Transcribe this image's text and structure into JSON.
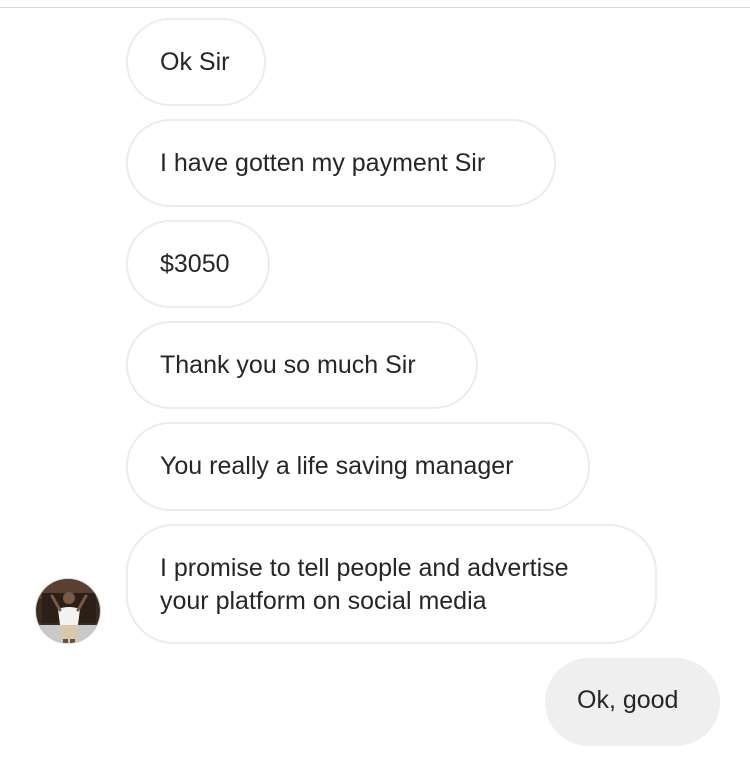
{
  "messages": [
    {
      "from": "them",
      "text": "Ok Sir"
    },
    {
      "from": "them",
      "text": "I have gotten my payment Sir"
    },
    {
      "from": "them",
      "text": "$3050"
    },
    {
      "from": "them",
      "text": "Thank you so much Sir"
    },
    {
      "from": "them",
      "text": "You really a life saving manager"
    },
    {
      "from": "them",
      "lines": [
        "I promise to tell people and advertise",
        "your platform on social media"
      ]
    },
    {
      "from": "me",
      "text": "Ok, good"
    }
  ],
  "avatar": {
    "icon": "profile-photo-icon"
  },
  "colors": {
    "incoming_bg": "#ffffff",
    "incoming_border": "#ececec",
    "outgoing_bg": "#efefef",
    "text": "#262626"
  }
}
